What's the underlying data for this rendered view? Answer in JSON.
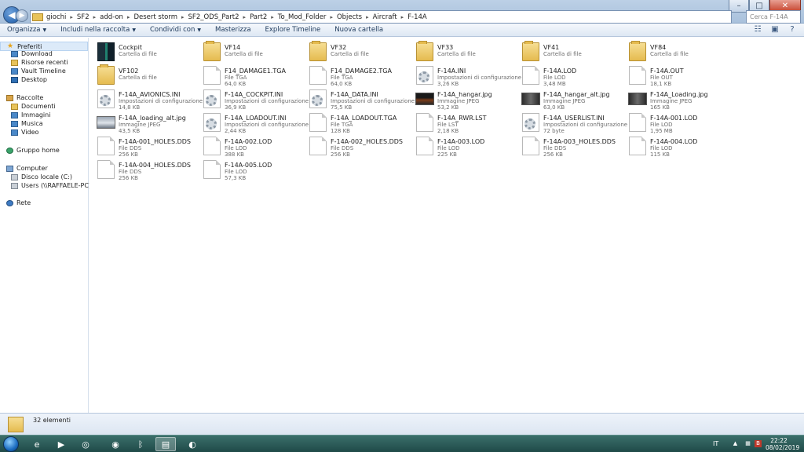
{
  "window": {
    "controls": {
      "minimize": "–",
      "maximize": "□",
      "close": "✕"
    }
  },
  "address": {
    "crumbs": [
      "giochi",
      "SF2",
      "add-on",
      "Desert storm",
      "SF2_ODS_Part2",
      "Part2",
      "To_Mod_Folder",
      "Objects",
      "Aircraft",
      "F-14A"
    ],
    "separator": "▸"
  },
  "search": {
    "placeholder": "Cerca F-14A"
  },
  "toolbar": {
    "items": [
      {
        "label": "Organizza",
        "has_menu": true
      },
      {
        "label": "Includi nella raccolta",
        "has_menu": true
      },
      {
        "label": "Condividi con",
        "has_menu": true
      },
      {
        "label": "Masterizza",
        "has_menu": false
      },
      {
        "label": "Explore Timeline",
        "has_menu": false
      },
      {
        "label": "Nuova cartella",
        "has_menu": false
      }
    ]
  },
  "navpane": {
    "items": [
      {
        "label": "Preferiti",
        "icon": "star-icon",
        "level": 0,
        "selected": true
      },
      {
        "label": "Download",
        "icon": "download-folder-icon",
        "level": 1
      },
      {
        "label": "Risorse recenti",
        "icon": "recent-places-icon",
        "level": 1
      },
      {
        "label": "Vault Timeline",
        "icon": "vault-timeline-icon",
        "level": 1
      },
      {
        "label": "Desktop",
        "icon": "desktop-icon",
        "level": 1
      },
      {
        "label": "Raccolte",
        "icon": "libraries-icon",
        "level": 0
      },
      {
        "label": "Documenti",
        "icon": "documents-icon",
        "level": 1
      },
      {
        "label": "Immagini",
        "icon": "pictures-icon",
        "level": 1
      },
      {
        "label": "Musica",
        "icon": "music-icon",
        "level": 1
      },
      {
        "label": "Video",
        "icon": "videos-icon",
        "level": 1
      },
      {
        "label": "Gruppo home",
        "icon": "homegroup-icon",
        "level": 0
      },
      {
        "label": "Computer",
        "icon": "computer-icon",
        "level": 0
      },
      {
        "label": "Disco locale (C:)",
        "icon": "local-disk-icon",
        "level": 1
      },
      {
        "label": "Users (\\\\RAFFAELE-PC) (Z:)",
        "icon": "network-drive-icon",
        "level": 1
      },
      {
        "label": "Rete",
        "icon": "network-icon",
        "level": 0
      }
    ]
  },
  "files": [
    {
      "name": "Cockpit",
      "type": "Cartella di file",
      "size": "",
      "icon": "cockpit-folder-icon"
    },
    {
      "name": "VF14",
      "type": "Cartella di file",
      "size": "",
      "icon": "folder-icon"
    },
    {
      "name": "VF32",
      "type": "Cartella di file",
      "size": "",
      "icon": "folder-icon"
    },
    {
      "name": "VF33",
      "type": "Cartella di file",
      "size": "",
      "icon": "folder-icon"
    },
    {
      "name": "VF41",
      "type": "Cartella di file",
      "size": "",
      "icon": "folder-icon"
    },
    {
      "name": "VF84",
      "type": "Cartella di file",
      "size": "",
      "icon": "folder-icon"
    },
    {
      "name": "VF102",
      "type": "Cartella di file",
      "size": "",
      "icon": "folder-icon"
    },
    {
      "name": "F14_DAMAGE1.TGA",
      "type": "File TGA",
      "size": "64,0 KB",
      "icon": "file-icon"
    },
    {
      "name": "F14_DAMAGE2.TGA",
      "type": "File TGA",
      "size": "64,0 KB",
      "icon": "file-icon"
    },
    {
      "name": "F-14A.INI",
      "type": "Impostazioni di configurazione",
      "size": "3,26 KB",
      "icon": "config-file-icon"
    },
    {
      "name": "F-14A.LOD",
      "type": "File LOD",
      "size": "3,48 MB",
      "icon": "file-icon"
    },
    {
      "name": "F-14A.OUT",
      "type": "File OUT",
      "size": "18,1 KB",
      "icon": "file-icon"
    },
    {
      "name": "F-14A_AVIONICS.INI",
      "type": "Impostazioni di configurazione",
      "size": "14,8 KB",
      "icon": "config-file-icon"
    },
    {
      "name": "F-14A_COCKPIT.INI",
      "type": "Impostazioni di configurazione",
      "size": "36,9 KB",
      "icon": "config-file-icon"
    },
    {
      "name": "F-14A_DATA.INI",
      "type": "Impostazioni di configurazione",
      "size": "75,5 KB",
      "icon": "config-file-icon"
    },
    {
      "name": "F-14A_hangar.jpg",
      "type": "Immagine JPEG",
      "size": "53,2 KB",
      "icon": "image-night-icon"
    },
    {
      "name": "F-14A_hangar_alt.jpg",
      "type": "Immagine JPEG",
      "size": "63,0 KB",
      "icon": "image-dark-icon"
    },
    {
      "name": "F-14A_Loading.jpg",
      "type": "Immagine JPEG",
      "size": "165 KB",
      "icon": "image-dark-icon"
    },
    {
      "name": "F-14A_loading_alt.jpg",
      "type": "Immagine JPEG",
      "size": "43,5 KB",
      "icon": "image-jet-icon"
    },
    {
      "name": "F-14A_LOADOUT.INI",
      "type": "Impostazioni di configurazione",
      "size": "2,44 KB",
      "icon": "config-file-icon"
    },
    {
      "name": "F-14A_LOADOUT.TGA",
      "type": "File TGA",
      "size": "128 KB",
      "icon": "file-icon"
    },
    {
      "name": "F-14A_RWR.LST",
      "type": "File LST",
      "size": "2,18 KB",
      "icon": "file-icon"
    },
    {
      "name": "F-14A_USERLIST.INI",
      "type": "Impostazioni di configurazione",
      "size": "72 byte",
      "icon": "config-file-icon"
    },
    {
      "name": "F-14A-001.LOD",
      "type": "File LOD",
      "size": "1,95 MB",
      "icon": "file-icon"
    },
    {
      "name": "F-14A-001_HOLES.DDS",
      "type": "File DDS",
      "size": "256 KB",
      "icon": "file-icon"
    },
    {
      "name": "F-14A-002.LOD",
      "type": "File LOD",
      "size": "388 KB",
      "icon": "file-icon"
    },
    {
      "name": "F-14A-002_HOLES.DDS",
      "type": "File DDS",
      "size": "256 KB",
      "icon": "file-icon"
    },
    {
      "name": "F-14A-003.LOD",
      "type": "File LOD",
      "size": "225 KB",
      "icon": "file-icon"
    },
    {
      "name": "F-14A-003_HOLES.DDS",
      "type": "File DDS",
      "size": "256 KB",
      "icon": "file-icon"
    },
    {
      "name": "F-14A-004.LOD",
      "type": "File LOD",
      "size": "115 KB",
      "icon": "file-icon"
    },
    {
      "name": "F-14A-004_HOLES.DDS",
      "type": "File DDS",
      "size": "256 KB",
      "icon": "file-icon"
    },
    {
      "name": "F-14A-005.LOD",
      "type": "File LOD",
      "size": "57,3 KB",
      "icon": "file-icon"
    }
  ],
  "statusbar": {
    "count_text": "32 elementi"
  },
  "taskbar": {
    "apps": [
      "internet-explorer-icon",
      "media-player-icon",
      "steam-icon",
      "chrome-icon",
      "bluetooth-icon",
      "file-explorer-icon",
      "firefox-icon"
    ],
    "active_app": "file-explorer-icon",
    "language": "IT",
    "time": "22:22",
    "date": "08/02/2019"
  }
}
